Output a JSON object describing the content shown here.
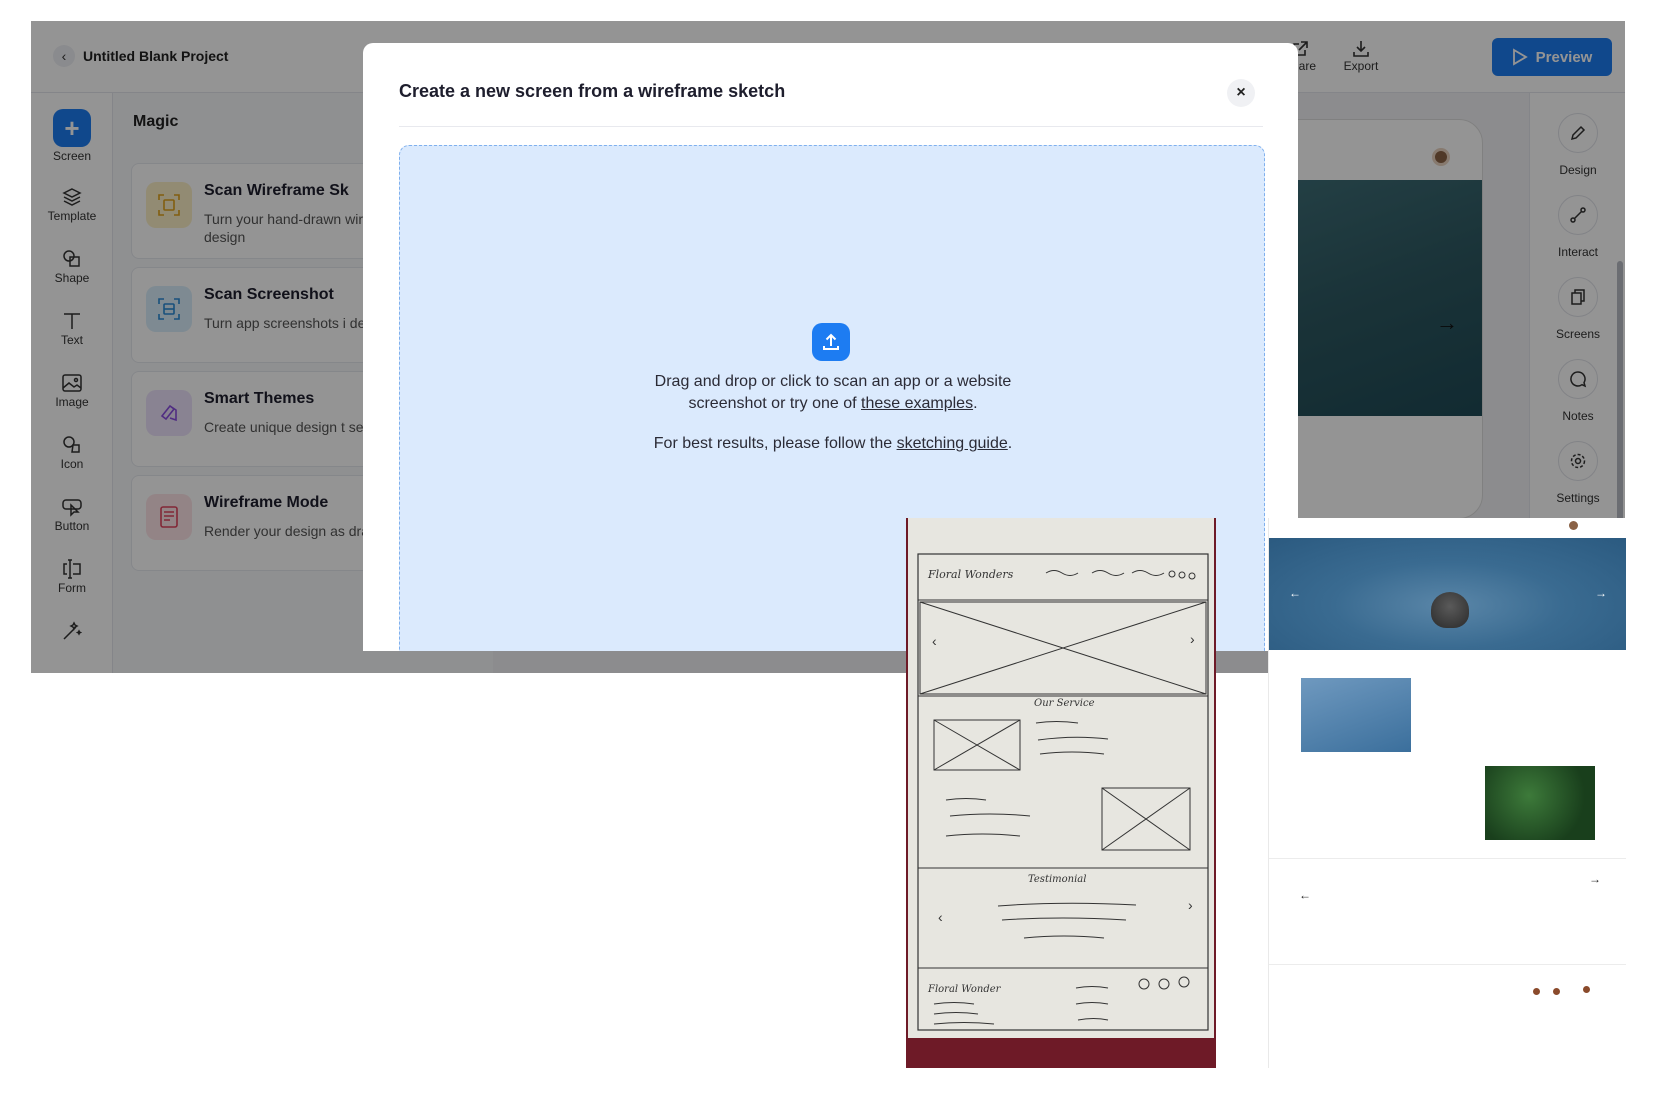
{
  "topbar": {
    "project_title": "Untitled Blank Project",
    "share_label": "Share",
    "export_label": "Export",
    "preview_label": "Preview"
  },
  "leftbar": {
    "items": [
      {
        "label": "Screen",
        "icon": "plus-icon"
      },
      {
        "label": "Template",
        "icon": "layers-icon"
      },
      {
        "label": "Shape",
        "icon": "shape-icon"
      },
      {
        "label": "Text",
        "icon": "text-icon"
      },
      {
        "label": "Image",
        "icon": "image-icon"
      },
      {
        "label": "Icon",
        "icon": "icon-shapes-icon"
      },
      {
        "label": "Button",
        "icon": "button-icon"
      },
      {
        "label": "Form",
        "icon": "form-icon"
      },
      {
        "label": "",
        "icon": "magic-wand-icon"
      }
    ]
  },
  "magic": {
    "title": "Magic",
    "cards": [
      {
        "title": "Scan Wireframe Sk",
        "desc": "Turn your hand-drawn wireframes into design",
        "icon": "scan-wireframe-icon",
        "color": "#fcefc7"
      },
      {
        "title": "Scan Screenshot",
        "desc": "Turn app screenshots i design mockups",
        "icon": "scan-screenshot-icon",
        "color": "#d9eefc"
      },
      {
        "title": "Smart Themes",
        "desc": "Create unique design t seconds",
        "icon": "smart-themes-icon",
        "color": "#ece2fb"
      },
      {
        "title": "Wireframe Mode",
        "desc": "Render your design as drawn sketch",
        "icon": "wireframe-mode-icon",
        "color": "#fde3e7"
      }
    ]
  },
  "rightbar": {
    "items": [
      {
        "label": "Design",
        "icon": "pencil-icon"
      },
      {
        "label": "Interact",
        "icon": "interact-icon"
      },
      {
        "label": "Screens",
        "icon": "screens-icon"
      },
      {
        "label": "Notes",
        "icon": "notes-icon"
      },
      {
        "label": "Settings",
        "icon": "gear-icon"
      }
    ]
  },
  "modal": {
    "title": "Create a new screen from a wireframe sketch",
    "close_label": "×",
    "dropzone": {
      "line1": "Drag and drop or click to scan an app or a website",
      "line2_prefix": "screenshot or try one of ",
      "line2_link": "these examples",
      "line2_suffix": ".",
      "line3_prefix": "For best results, please follow the ",
      "line3_link": "sketching guide",
      "line3_suffix": "."
    }
  },
  "sketch": {
    "header_text": "Floral Wonders",
    "service_text": "Our Service",
    "testimonial_text": "Testimonial",
    "footer_text": "Floral Wonder"
  },
  "colors": {
    "accent": "#1d7cf2",
    "dropzone_bg": "#dbeafd",
    "overlay": "rgba(0,0,0,0.42)"
  }
}
